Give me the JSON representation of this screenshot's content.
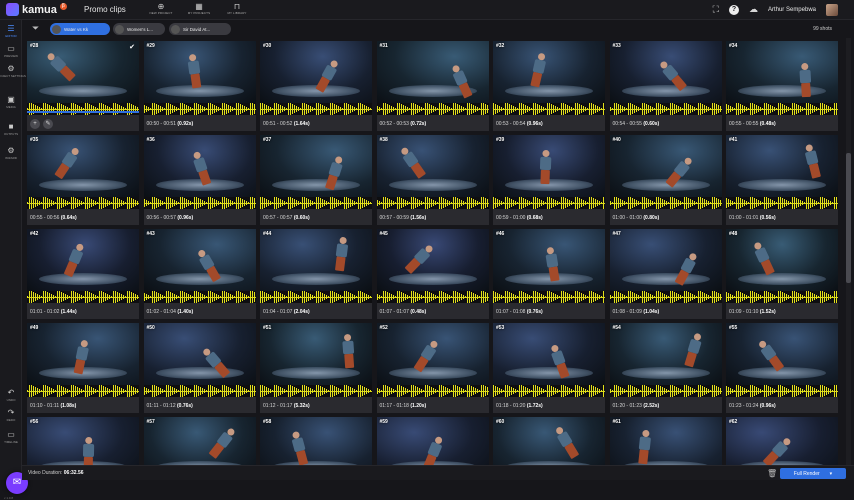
{
  "app": {
    "logo_text": "kamua",
    "logo_badge": "β",
    "project_title": "Promo clips"
  },
  "topnav": [
    {
      "icon": "⊕",
      "label": "NEW PROJECT",
      "name": "new-project"
    },
    {
      "icon": "▦",
      "label": "MY PROJECTS",
      "name": "my-projects"
    },
    {
      "icon": "⊓",
      "label": "MY LIBRARY",
      "name": "my-library"
    }
  ],
  "topright": {
    "expand_icon": "⛶",
    "help_icon": "?",
    "cloud_icon": "☁",
    "user_name": "Arthur Sempebwa"
  },
  "sidebar": {
    "items": [
      {
        "icon": "☰",
        "label": "EDITOR",
        "name": "editor",
        "active": true
      },
      {
        "icon": "▭",
        "label": "PREVIEW",
        "name": "preview",
        "active": false
      },
      {
        "icon": "⚙",
        "label": "PROJECT SETTINGS",
        "name": "project-settings",
        "active": false
      },
      {
        "icon": "▣",
        "label": "MEDIA",
        "name": "media",
        "active": false
      },
      {
        "icon": "■",
        "label": "OUTPUTS",
        "name": "outputs",
        "active": false
      },
      {
        "icon": "⚙",
        "label": "WIZARD",
        "name": "wizard",
        "active": false
      }
    ],
    "bottom_items": [
      {
        "icon": "↶",
        "label": "UNDO",
        "name": "undo"
      },
      {
        "icon": "↷",
        "label": "REDO",
        "name": "redo"
      },
      {
        "icon": "▭",
        "label": "TIMELINE",
        "name": "timeline"
      }
    ],
    "chat_icon": "✉",
    "version": "v 1.0.8"
  },
  "filters": {
    "chips": [
      {
        "label": "Water vs Kk",
        "active": true
      },
      {
        "label": "Women's L...",
        "active": false
      },
      {
        "label": "Sir David At...",
        "active": false
      }
    ],
    "shot_count": "99 shots"
  },
  "shots": [
    {
      "no": "#28",
      "time": "",
      "dur": "",
      "selected": true
    },
    {
      "no": "#29",
      "time": "00:50 - 00:51",
      "dur": "(0.92s)"
    },
    {
      "no": "#30",
      "time": "00:51 - 00:52",
      "dur": "(1.64s)"
    },
    {
      "no": "#31",
      "time": "00:52 - 00:53",
      "dur": "(0.72s)"
    },
    {
      "no": "#32",
      "time": "00:53 - 00:54",
      "dur": "(0.96s)"
    },
    {
      "no": "#33",
      "time": "00:54 - 00:55",
      "dur": "(0.60s)"
    },
    {
      "no": "#34",
      "time": "00:55 - 00:55",
      "dur": "(0.48s)"
    },
    {
      "no": "#35",
      "time": "00:55 - 00:56",
      "dur": "(0.64s)"
    },
    {
      "no": "#36",
      "time": "00:56 - 00:57",
      "dur": "(0.96s)"
    },
    {
      "no": "#37",
      "time": "00:57 - 00:57",
      "dur": "(0.60s)"
    },
    {
      "no": "#38",
      "time": "00:57 - 00:59",
      "dur": "(1.56s)"
    },
    {
      "no": "#39",
      "time": "00:59 - 01:00",
      "dur": "(0.68s)"
    },
    {
      "no": "#40",
      "time": "01:00 - 01:00",
      "dur": "(0.80s)"
    },
    {
      "no": "#41",
      "time": "01:00 - 01:01",
      "dur": "(0.56s)"
    },
    {
      "no": "#42",
      "time": "01:01 - 01:02",
      "dur": "(1.44s)"
    },
    {
      "no": "#43",
      "time": "01:02 - 01:04",
      "dur": "(1.40s)"
    },
    {
      "no": "#44",
      "time": "01:04 - 01:07",
      "dur": "(2.04s)"
    },
    {
      "no": "#45",
      "time": "01:07 - 01:07",
      "dur": "(0.48s)"
    },
    {
      "no": "#46",
      "time": "01:07 - 01:08",
      "dur": "(0.76s)"
    },
    {
      "no": "#47",
      "time": "01:08 - 01:09",
      "dur": "(1.04s)"
    },
    {
      "no": "#48",
      "time": "01:09 - 01:10",
      "dur": "(1.52s)"
    },
    {
      "no": "#49",
      "time": "01:10 - 01:11",
      "dur": "(1.08s)"
    },
    {
      "no": "#50",
      "time": "01:11 - 01:12",
      "dur": "(0.76s)"
    },
    {
      "no": "#51",
      "time": "01:12 - 01:17",
      "dur": "(5.32s)"
    },
    {
      "no": "#52",
      "time": "01:17 - 01:18",
      "dur": "(1.20s)"
    },
    {
      "no": "#53",
      "time": "01:18 - 01:20",
      "dur": "(1.72s)"
    },
    {
      "no": "#54",
      "time": "01:20 - 01:23",
      "dur": "(2.52s)"
    },
    {
      "no": "#55",
      "time": "01:23 - 01:24",
      "dur": "(0.96s)"
    },
    {
      "no": "#56",
      "time": "",
      "dur": ""
    },
    {
      "no": "#57",
      "time": "",
      "dur": ""
    },
    {
      "no": "#58",
      "time": "",
      "dur": ""
    },
    {
      "no": "#59",
      "time": "",
      "dur": ""
    },
    {
      "no": "#60",
      "time": "",
      "dur": ""
    },
    {
      "no": "#61",
      "time": "",
      "dur": ""
    },
    {
      "no": "#62",
      "time": "",
      "dur": ""
    }
  ],
  "footer": {
    "duration_label": "Video Duration:",
    "duration_value": "06:32.56",
    "trash_icon": "🗑",
    "render_label": "Full Render",
    "render_caret": "▾"
  },
  "colors": {
    "accent": "#2f6fe0",
    "waveform": "#e2e01c",
    "background": "#16161a",
    "card": "#2a2a2f"
  }
}
